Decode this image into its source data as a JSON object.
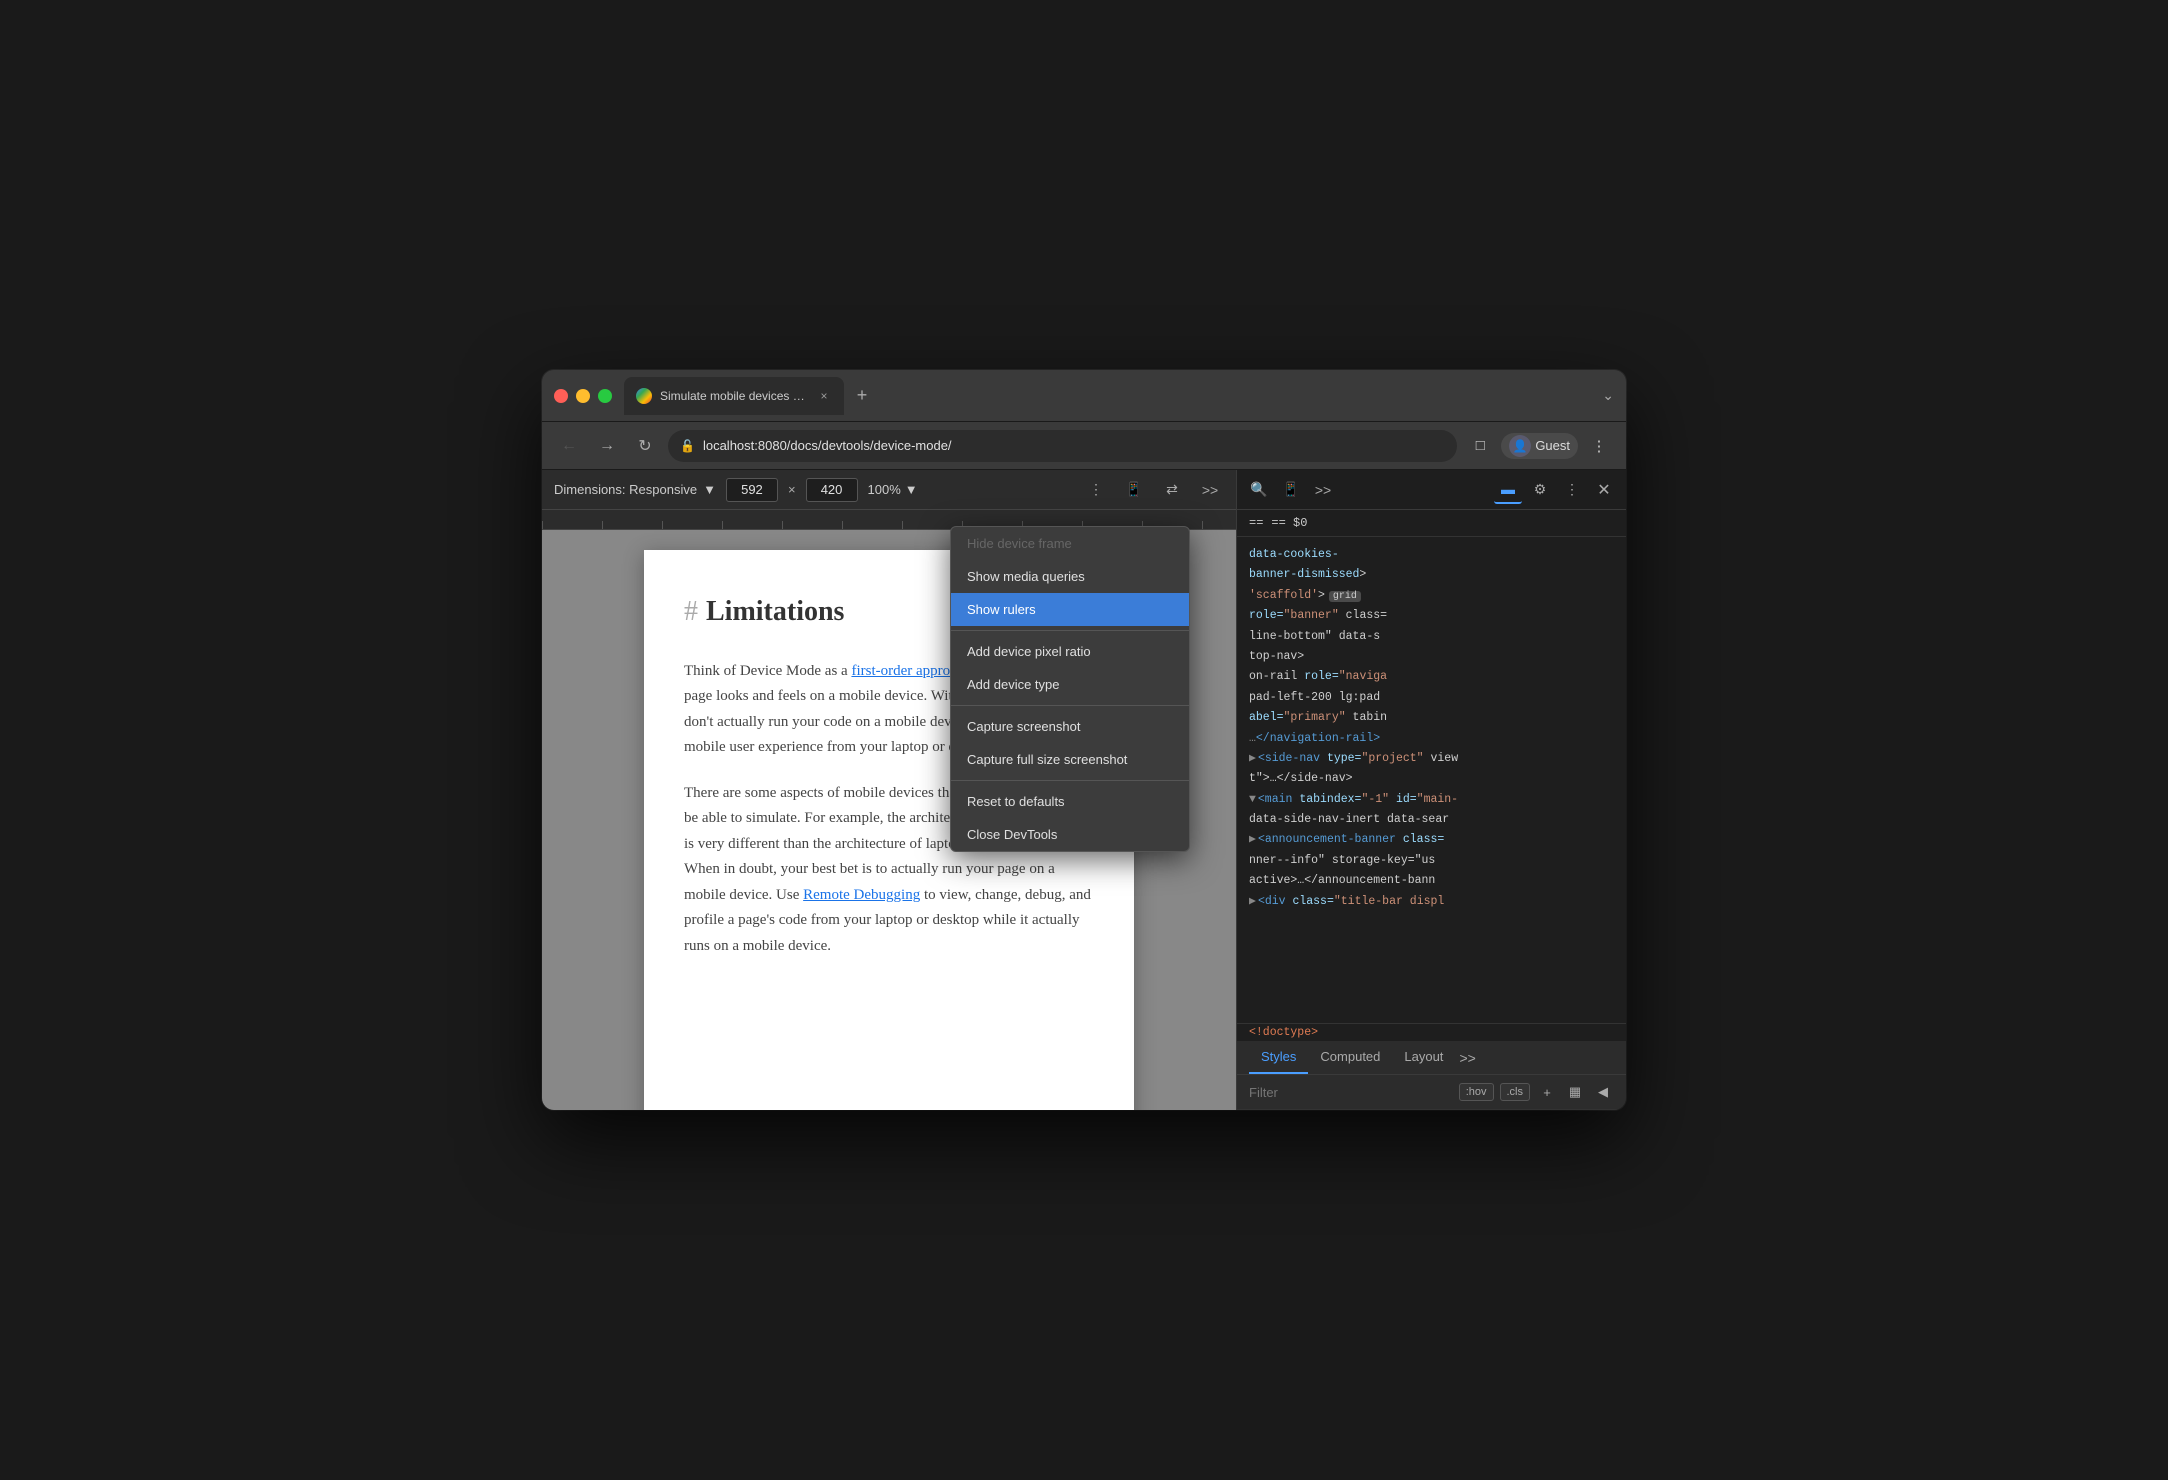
{
  "browser": {
    "title": "Simulate mobile devices with D",
    "tab_close": "×",
    "new_tab": "+",
    "chevron": "⌄",
    "address": "localhost:8080/docs/devtools/device-mode/",
    "profile_label": "Guest"
  },
  "device_toolbar": {
    "dimensions_label": "Dimensions: Responsive",
    "width_value": "592",
    "height_value": "420",
    "zoom_label": "100%",
    "more_label": "⋮"
  },
  "page": {
    "heading_hash": "#",
    "heading": "Limitations",
    "para1_start": "Think of Device Mode as a ",
    "para1_link": "first-order approximation",
    "para1_end": " of how your page looks and feels on a mobile device. With Device Mode you don't actually run your code on a mobile device. You simulate the mobile user experience from your laptop or desktop.",
    "para2_start": "There are some aspects of mobile devices that DevTools will never be able to simulate. For example, the architecture of mobile CPUs is very different than the architecture of laptop or desktop CPUs. When in doubt, your best bet is to actually run your page on a mobile device. Use ",
    "para2_link": "Remote Debugging",
    "para2_end": " to view, change, debug, and profile a page's code from your laptop or desktop while it actually runs on a mobile device."
  },
  "context_menu": {
    "hide_device_frame": "Hide device frame",
    "show_media_queries": "Show media queries",
    "show_rulers": "Show rulers",
    "add_device_pixel_ratio": "Add device pixel ratio",
    "add_device_type": "Add device type",
    "capture_screenshot": "Capture screenshot",
    "capture_full_screenshot": "Capture full size screenshot",
    "reset_to_defaults": "Reset to defaults",
    "close_devtools": "Close DevTools"
  },
  "devtools": {
    "element_info": "== $0",
    "tabs": {
      "styles": "Styles",
      "computed": "Computed",
      "layout": "Layout",
      "more": ">>"
    },
    "filter_placeholder": "Filter",
    "hov_btn": ":hov",
    "cls_btn": ".cls",
    "doctype": "<!doctype>",
    "html_lines": [
      "data-cookies-",
      "banner-dismissed>",
      "'scaffold'> grid",
      "role=\"banner\" class=",
      "line-bottom\" data-s",
      "top-nav>",
      "on-rail role=\"naviga",
      "pad-left-200 lg:pad",
      "abel=\"primary\" tabin",
      "…</navigation-rail>",
      "<side-nav type=\"project\" view",
      "t\">…</side-nav>",
      "<main tabindex=\"-1\" id=\"main-",
      "data-side-nav-inert data-sear",
      "<announcement-banner class=",
      "nner--info\" storage-key=\"us",
      "active>…</announcement-bann",
      "<div class=\"title-bar displ"
    ]
  }
}
